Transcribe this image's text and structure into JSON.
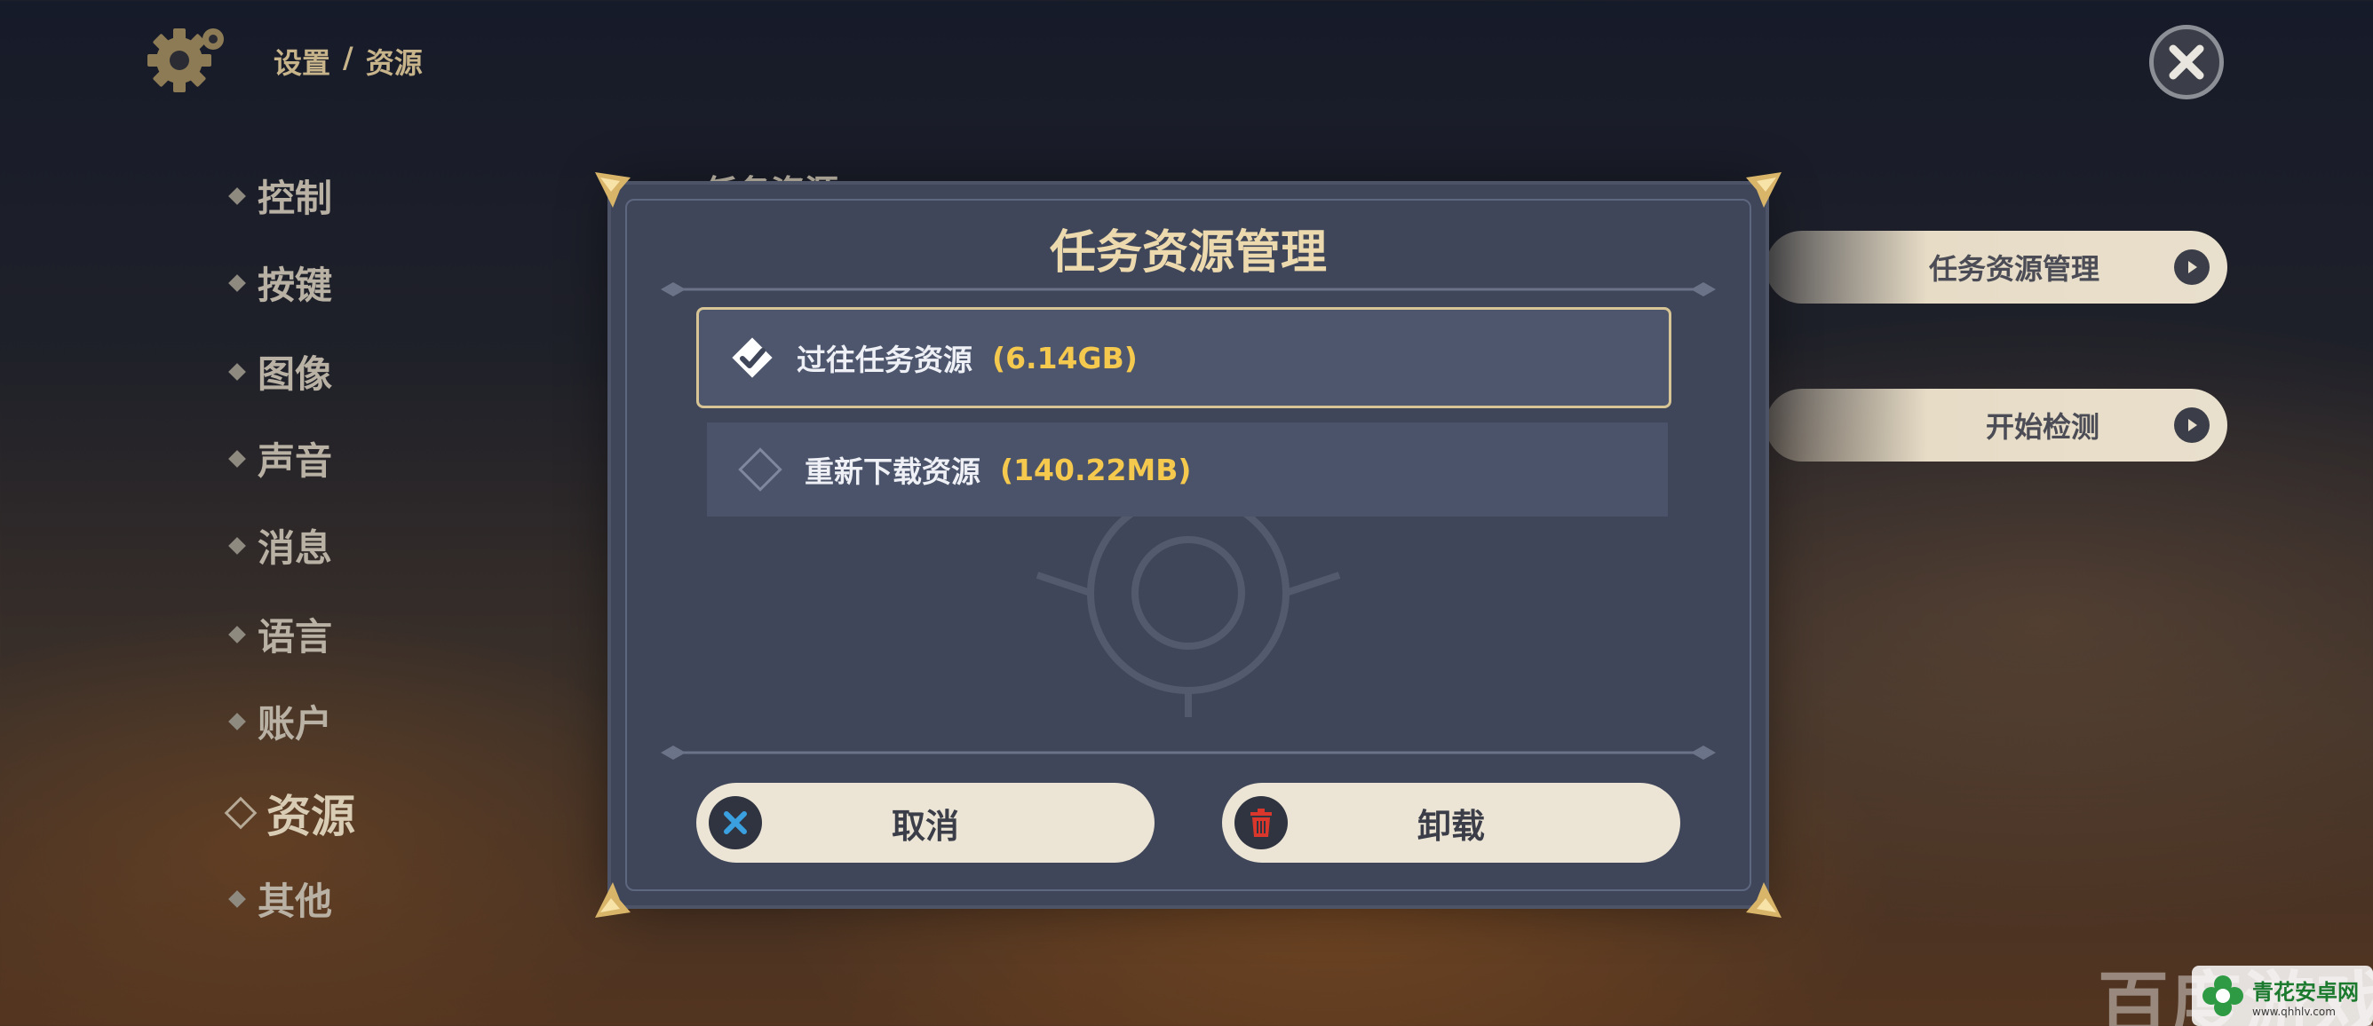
{
  "breadcrumb": {
    "root": "设置",
    "separator": "/",
    "current": "资源"
  },
  "sidebar": {
    "items": [
      {
        "label": "控制"
      },
      {
        "label": "按键"
      },
      {
        "label": "图像"
      },
      {
        "label": "声音"
      },
      {
        "label": "消息"
      },
      {
        "label": "语言"
      },
      {
        "label": "账户"
      },
      {
        "label": "资源",
        "active": true
      },
      {
        "label": "其他"
      }
    ]
  },
  "right_panel": {
    "section_title_partial": "任务资源",
    "buttons": [
      {
        "label": "任务资源管理"
      },
      {
        "label": "开始检测"
      }
    ]
  },
  "modal": {
    "title": "任务资源管理",
    "options": [
      {
        "label": "过往任务资源",
        "size": "(6.14GB)",
        "checked": true
      },
      {
        "label": "重新下载资源",
        "size": "(140.22MB)",
        "checked": false
      }
    ],
    "cancel_label": "取消",
    "uninstall_label": "卸载"
  },
  "watermark": {
    "baidu_text": "百度游戏",
    "site_name": "青花安卓网",
    "site_url": "www.qhhlv.com"
  },
  "colors": {
    "accent_gold": "#f5c84e",
    "title_gold": "#ecd9ae",
    "modal_bg": "#3f4659",
    "pill_bg": "#ece5d6",
    "cancel_icon": "#3aa0e0",
    "delete_icon": "#d9372b"
  },
  "icons": {
    "settings": "gear-icon",
    "close": "close-icon",
    "arrow": "arrow-right-icon",
    "checkbox_checked": "checkbox-checked-icon",
    "checkbox_empty": "checkbox-empty-icon",
    "cancel": "x-icon",
    "delete": "trash-icon"
  }
}
